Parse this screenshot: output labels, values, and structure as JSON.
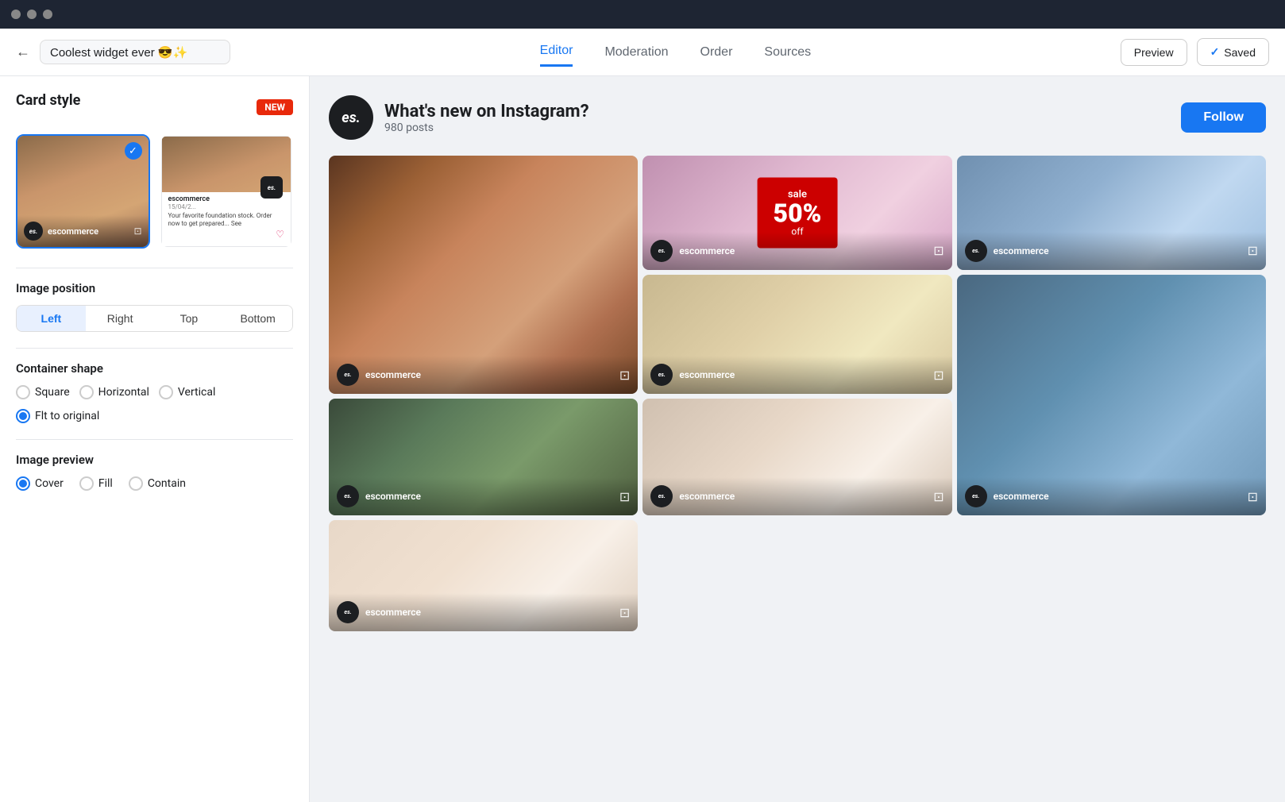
{
  "titlebar": {
    "dots": [
      "dot1",
      "dot2",
      "dot3"
    ]
  },
  "topnav": {
    "back_label": "←",
    "title": "Coolest widget ever 😎✨",
    "title_icon": "✏️",
    "tabs": [
      {
        "id": "editor",
        "label": "Editor",
        "active": true
      },
      {
        "id": "moderation",
        "label": "Moderation",
        "active": false
      },
      {
        "id": "order",
        "label": "Order",
        "active": false
      },
      {
        "id": "sources",
        "label": "Sources",
        "active": false
      }
    ],
    "preview_label": "Preview",
    "saved_label": "Saved",
    "check_icon": "✓"
  },
  "left_panel": {
    "card_style_title": "Card style",
    "new_badge": "NEW",
    "card_options": [
      {
        "id": "card-1",
        "selected": true,
        "type": "full-image"
      },
      {
        "id": "card-2",
        "selected": false,
        "type": "text-card"
      }
    ],
    "card1_name": "escommerce",
    "card2_name": "escommerce",
    "card2_date": "15/04/2...",
    "card2_text": "Your favorite foundation stock. Order now to get prepared... See",
    "image_position_title": "Image position",
    "position_tabs": [
      {
        "label": "Left",
        "active": true
      },
      {
        "label": "Right",
        "active": false
      },
      {
        "label": "Top",
        "active": false
      },
      {
        "label": "Bottom",
        "active": false
      }
    ],
    "container_shape_title": "Container shape",
    "shape_options": [
      {
        "label": "Square",
        "checked": false
      },
      {
        "label": "Horizontal",
        "checked": false
      },
      {
        "label": "Vertical",
        "checked": false
      },
      {
        "label": "Flt to original",
        "checked": true
      }
    ],
    "image_preview_title": "Image preview",
    "preview_options": [
      {
        "label": "Cover",
        "checked": true
      },
      {
        "label": "Fill",
        "checked": false
      },
      {
        "label": "Contain",
        "checked": false
      }
    ]
  },
  "right_panel": {
    "logo_text": "es.",
    "widget_title": "What's new on Instagram?",
    "widget_posts": "980 posts",
    "follow_label": "Follow",
    "posts": [
      {
        "id": "post-1",
        "bg": "post-bg-1",
        "username": "escommerce",
        "tall": true
      },
      {
        "id": "post-2",
        "bg": "post-bg-2",
        "username": "escommerce",
        "sale": true
      },
      {
        "id": "post-3",
        "bg": "post-bg-3",
        "username": "escommerce"
      },
      {
        "id": "post-4",
        "bg": "post-bg-4",
        "username": "escommerce"
      },
      {
        "id": "post-5",
        "bg": "post-bg-5",
        "username": "escommerce"
      },
      {
        "id": "post-6",
        "bg": "post-bg-6",
        "username": "escommerce"
      },
      {
        "id": "post-7",
        "bg": "post-bg-5",
        "username": "escommerce"
      },
      {
        "id": "post-8",
        "bg": "post-bg-6",
        "username": "escommerce"
      }
    ],
    "sale_text": "sale",
    "sale_percent": "50%",
    "sale_off": "off"
  }
}
